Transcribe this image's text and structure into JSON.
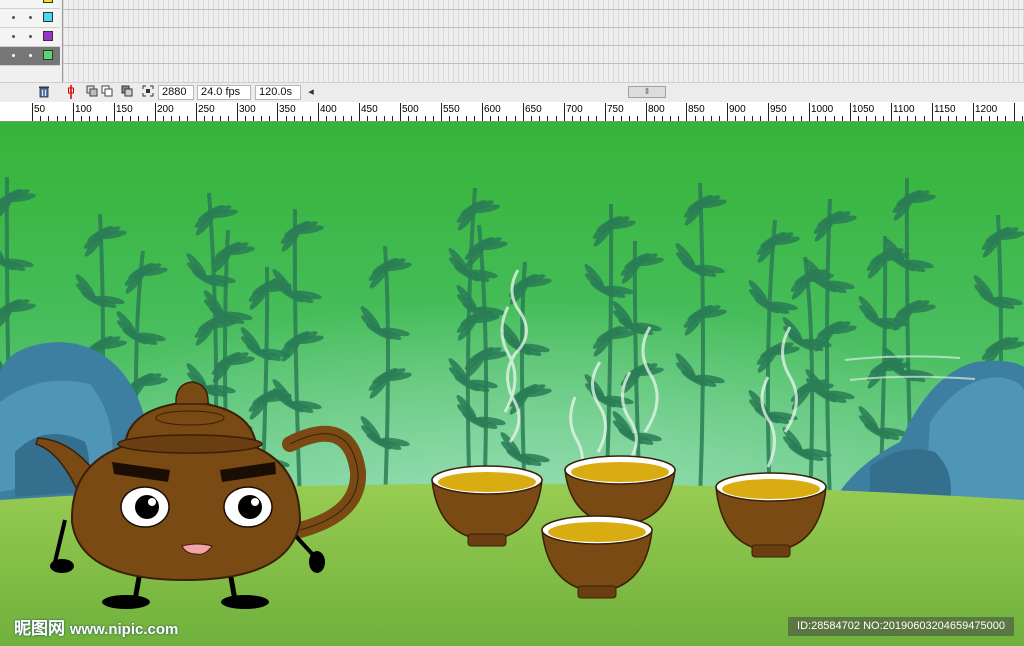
{
  "layers": [
    {
      "color": "#e8e800",
      "active": false
    },
    {
      "color": "#48d8e8",
      "active": false
    },
    {
      "color": "#9b35c9",
      "active": false
    },
    {
      "color": "#59d66c",
      "active": true
    }
  ],
  "timeline_toolbar": {
    "trash_icon": "trash-icon",
    "frame_count": "2880",
    "fps": "24.0 fps",
    "elapsed": "120.0s",
    "scroll_left_glyph": "◂",
    "scroll_thumb_glyph": "⦀"
  },
  "ruler": {
    "labels": [
      "50",
      "100",
      "150",
      "200",
      "250",
      "300",
      "350",
      "400",
      "450",
      "500",
      "550",
      "600",
      "650",
      "700",
      "750",
      "800",
      "850",
      "900",
      "950",
      "1000",
      "1050",
      "1100",
      "1150",
      "1200"
    ]
  },
  "colors": {
    "sky_top": "#35b438",
    "sky_bottom": "#7ed3a6",
    "bamboo": "#2a7d55",
    "rock": "#3d7fa0",
    "ground": "#88c44a",
    "pot": "#7a4a14",
    "tea": "#d9ad12"
  },
  "watermark": {
    "logo_text": "昵图网",
    "site": "www.nipic.com",
    "id_text": "ID:28584702 NO:20190603204659475000"
  }
}
